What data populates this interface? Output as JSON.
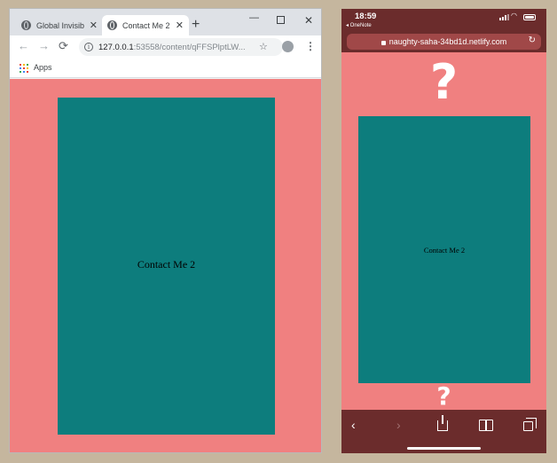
{
  "desktop": {
    "tabs": [
      {
        "label": "Global Invisib",
        "active": false
      },
      {
        "label": "Contact Me 2",
        "active": true
      }
    ],
    "new_tab_symbol": "+",
    "window_controls": {
      "minimize": "—",
      "close": "✕"
    },
    "nav": {
      "back": "←",
      "forward": "→",
      "reload": "⟳"
    },
    "address": {
      "host": "127.0.0.1",
      "path": ":53558/content/qFFSPlptLW..."
    },
    "bookmark_star": "☆",
    "menu_symbol": "⋮",
    "bookmarks_bar": {
      "apps_label": "Apps"
    },
    "page": {
      "card_text": "Contact Me 2"
    },
    "colors": {
      "page_bg": "#f08080",
      "card_bg": "#0d7d7d"
    }
  },
  "mobile": {
    "status": {
      "time": "18:59",
      "back_app": "◂ OneNote"
    },
    "url": "naughty-saha-34bd1d.netlify.com",
    "page": {
      "top_mark": "?",
      "card_text": "Contact Me 2",
      "bottom_mark": "?"
    },
    "toolbar": {
      "back": "‹",
      "forward": "›"
    },
    "colors": {
      "chrome_bg": "#6b2c2c",
      "page_bg": "#f08080",
      "card_bg": "#0d7d7d"
    }
  },
  "icons": [
    "globe-icon",
    "close-icon",
    "info-icon",
    "star-icon",
    "profile-icon",
    "kebab-menu-icon",
    "apps-grid-icon",
    "lock-icon",
    "reload-icon",
    "share-icon",
    "bookmarks-icon",
    "tabs-icon"
  ]
}
